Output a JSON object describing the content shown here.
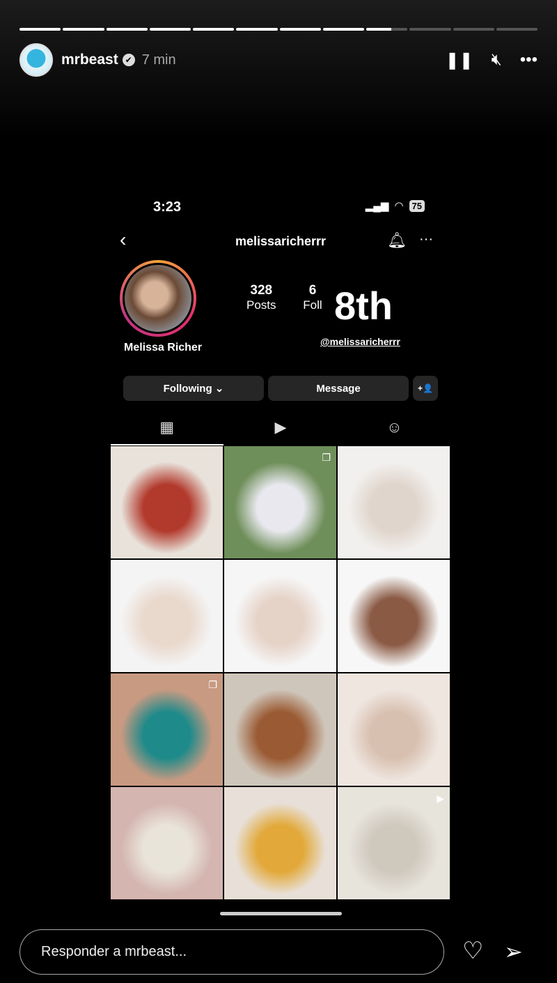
{
  "story": {
    "segments_total": 12,
    "segments_done": 8,
    "current_progress": 0.6
  },
  "header": {
    "username": "mrbeast",
    "verified": "✔",
    "time": "7 min",
    "pause_icon": "pause-icon",
    "mute_icon": "muted-icon",
    "more_icon": "more-icon"
  },
  "phone": {
    "clock": "3:23",
    "battery": "75",
    "profile": {
      "title": "melissaricherrr",
      "posts_count": "328",
      "posts_label": "Posts",
      "followers_count": "6",
      "followers_label": "Foll",
      "sticker": "8th",
      "mention": "@melissaricherrr",
      "name": "Melissa Richer",
      "buttons": {
        "following": "Following ⌄",
        "message": "Message",
        "add_user": "+👤"
      }
    },
    "tabs": [
      "grid-icon",
      "reels-icon",
      "tagged-icon"
    ],
    "photos": [
      {
        "colors": [
          "#e8e2da",
          "#b23a2d"
        ],
        "badge": ""
      },
      {
        "colors": [
          "#6f8f5a",
          "#e8e8ee"
        ],
        "badge": "❐"
      },
      {
        "colors": [
          "#f2f0ee",
          "#e0d5cc"
        ],
        "badge": ""
      },
      {
        "colors": [
          "#f4f4f4",
          "#e9d8cc"
        ],
        "badge": ""
      },
      {
        "colors": [
          "#f6f6f6",
          "#e6d3c8"
        ],
        "badge": ""
      },
      {
        "colors": [
          "#f7f7f7",
          "#8a5a44"
        ],
        "badge": ""
      },
      {
        "colors": [
          "#c89a82",
          "#1f8a8a"
        ],
        "badge": "❐"
      },
      {
        "colors": [
          "#cfc6bb",
          "#9a5a33"
        ],
        "badge": ""
      },
      {
        "colors": [
          "#efe6e0",
          "#d8c0b0"
        ],
        "badge": ""
      },
      {
        "colors": [
          "#d4b5b0",
          "#e9e4da"
        ],
        "badge": ""
      },
      {
        "colors": [
          "#e8e0d8",
          "#e2a93a"
        ],
        "badge": ""
      },
      {
        "colors": [
          "#e7e4dc",
          "#cfc8bd"
        ],
        "badge": "▶"
      }
    ]
  },
  "reply": {
    "placeholder": "Responder a mrbeast...",
    "heart_icon": "heart-icon",
    "send_icon": "send-icon"
  }
}
